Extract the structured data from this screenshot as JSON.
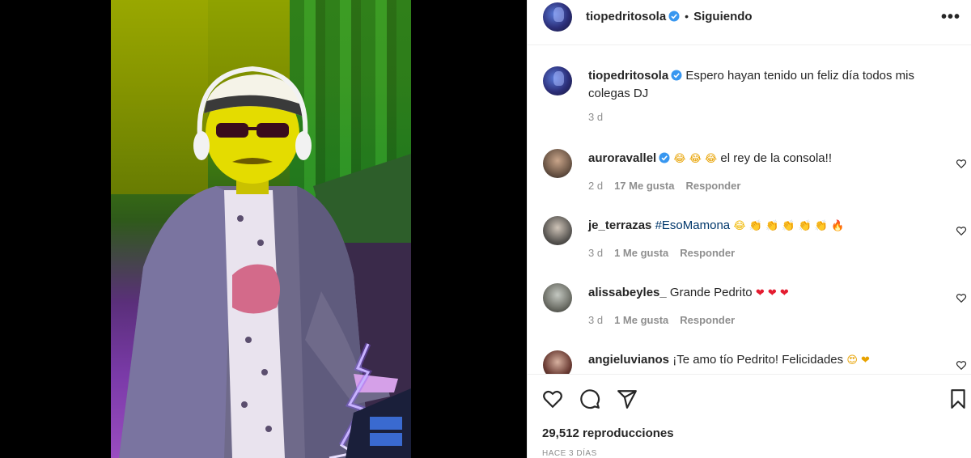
{
  "post": {
    "username": "tiopedritosola",
    "follow_status": "Siguiendo",
    "caption_user": "tiopedritosola",
    "caption": "Espero hayan tenido un feliz día todos mis colegas DJ",
    "caption_time": "3 d",
    "views": "29,512 reproducciones",
    "posted_ago": "HACE 3 DÍAS",
    "brand_verified_color": "#3897f0"
  },
  "comments": [
    {
      "user": "auroravallel",
      "verified": true,
      "prefix_emoji": "😂 😂 😂",
      "text": "el rey de la consola!!",
      "suffix_emoji": "",
      "time": "2 d",
      "likes": "17 Me gusta",
      "reply": "Responder"
    },
    {
      "user": "je_terrazas",
      "verified": false,
      "prefix_emoji": "",
      "text": "#EsoMamona",
      "suffix_emoji": "😂 👏 👏 👏 👏 👏 🔥",
      "time": "3 d",
      "likes": "1 Me gusta",
      "reply": "Responder"
    },
    {
      "user": "alissabeyles_",
      "verified": false,
      "prefix_emoji": "",
      "text": "Grande Pedrito",
      "suffix_emoji": "❤ ❤ ❤",
      "time": "3 d",
      "likes": "1 Me gusta",
      "reply": "Responder"
    },
    {
      "user": "angieluvianos",
      "verified": false,
      "prefix_emoji": "",
      "text": "¡Te amo tío Pedrito! Felicidades",
      "suffix_emoji": "😍 ❤",
      "time": "",
      "likes": "",
      "reply": ""
    }
  ],
  "icons": {
    "more": "more-options-icon",
    "like": "heart-icon",
    "comment": "comment-icon",
    "share": "send-icon",
    "save": "bookmark-icon"
  }
}
